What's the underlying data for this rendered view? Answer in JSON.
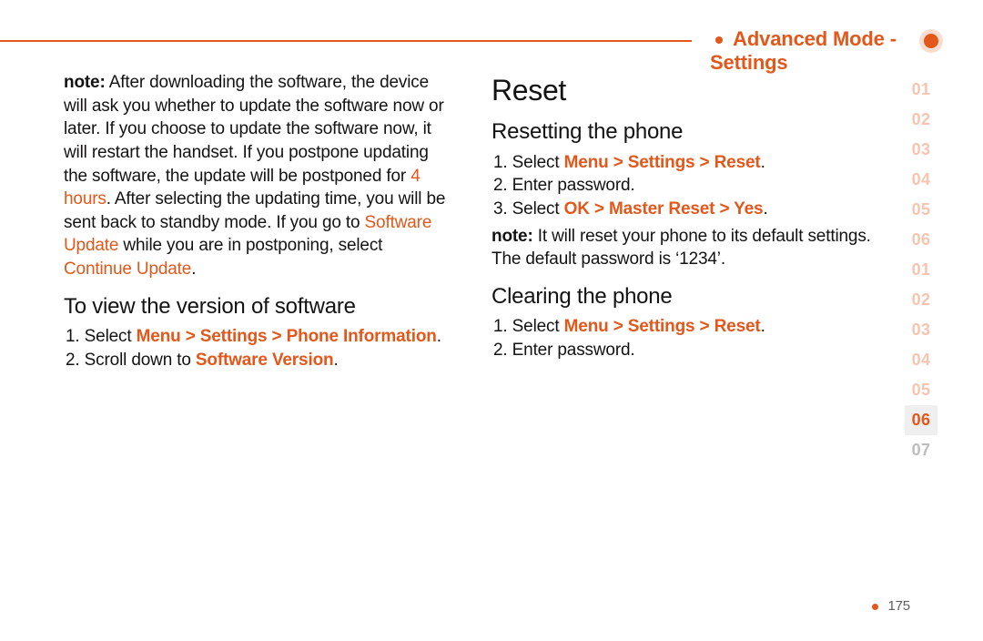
{
  "header": {
    "title": "Advanced Mode - Settings"
  },
  "left": {
    "note_label": "note:",
    "note_p1a": " After downloading the software, the device will ask you whether to update the software now or later. If you choose to update the software now, it will restart the handset. If you postpone updating the software, the update will be postponed for ",
    "note_hours": "4 hours",
    "note_p1b": ". After selecting the updating time, you will be sent back to standby mode. If you go to ",
    "note_su": "Software Update",
    "note_p1c": " while you are in postponing, select ",
    "note_cu": "Continue Update",
    "note_p1d": ".",
    "h_view": "To view the version of software",
    "s1_a": "1. Select ",
    "s1_b": "Menu > Settings > Phone Information",
    "s1_c": ".",
    "s2_a": "2. Scroll down to ",
    "s2_b": "Software Version",
    "s2_c": "."
  },
  "right": {
    "h_reset": "Reset",
    "h_resetting": "Resetting the phone",
    "r1_a": "1. Select ",
    "r1_b": "Menu > Settings > Reset",
    "r1_c": ".",
    "r2": "2. Enter password.",
    "r3_a": "3. Select ",
    "r3_b": "OK > Master Reset > Yes",
    "r3_c": ".",
    "note2_label": "note:",
    "note2_text": " It will reset your phone to its default settings. The default password is ‘1234’.",
    "h_clearing": "Clearing the phone",
    "c1_a": "1. Select ",
    "c1_b": "Menu > Settings > Reset",
    "c1_c": ".",
    "c2": "2. Enter password."
  },
  "sidebar": [
    "01",
    "02",
    "03",
    "04",
    "05",
    "06",
    "01",
    "02",
    "03",
    "04",
    "05",
    "06",
    "07"
  ],
  "sidebar_active_index": 11,
  "sidebar_grey_index": 12,
  "page_number": "175"
}
